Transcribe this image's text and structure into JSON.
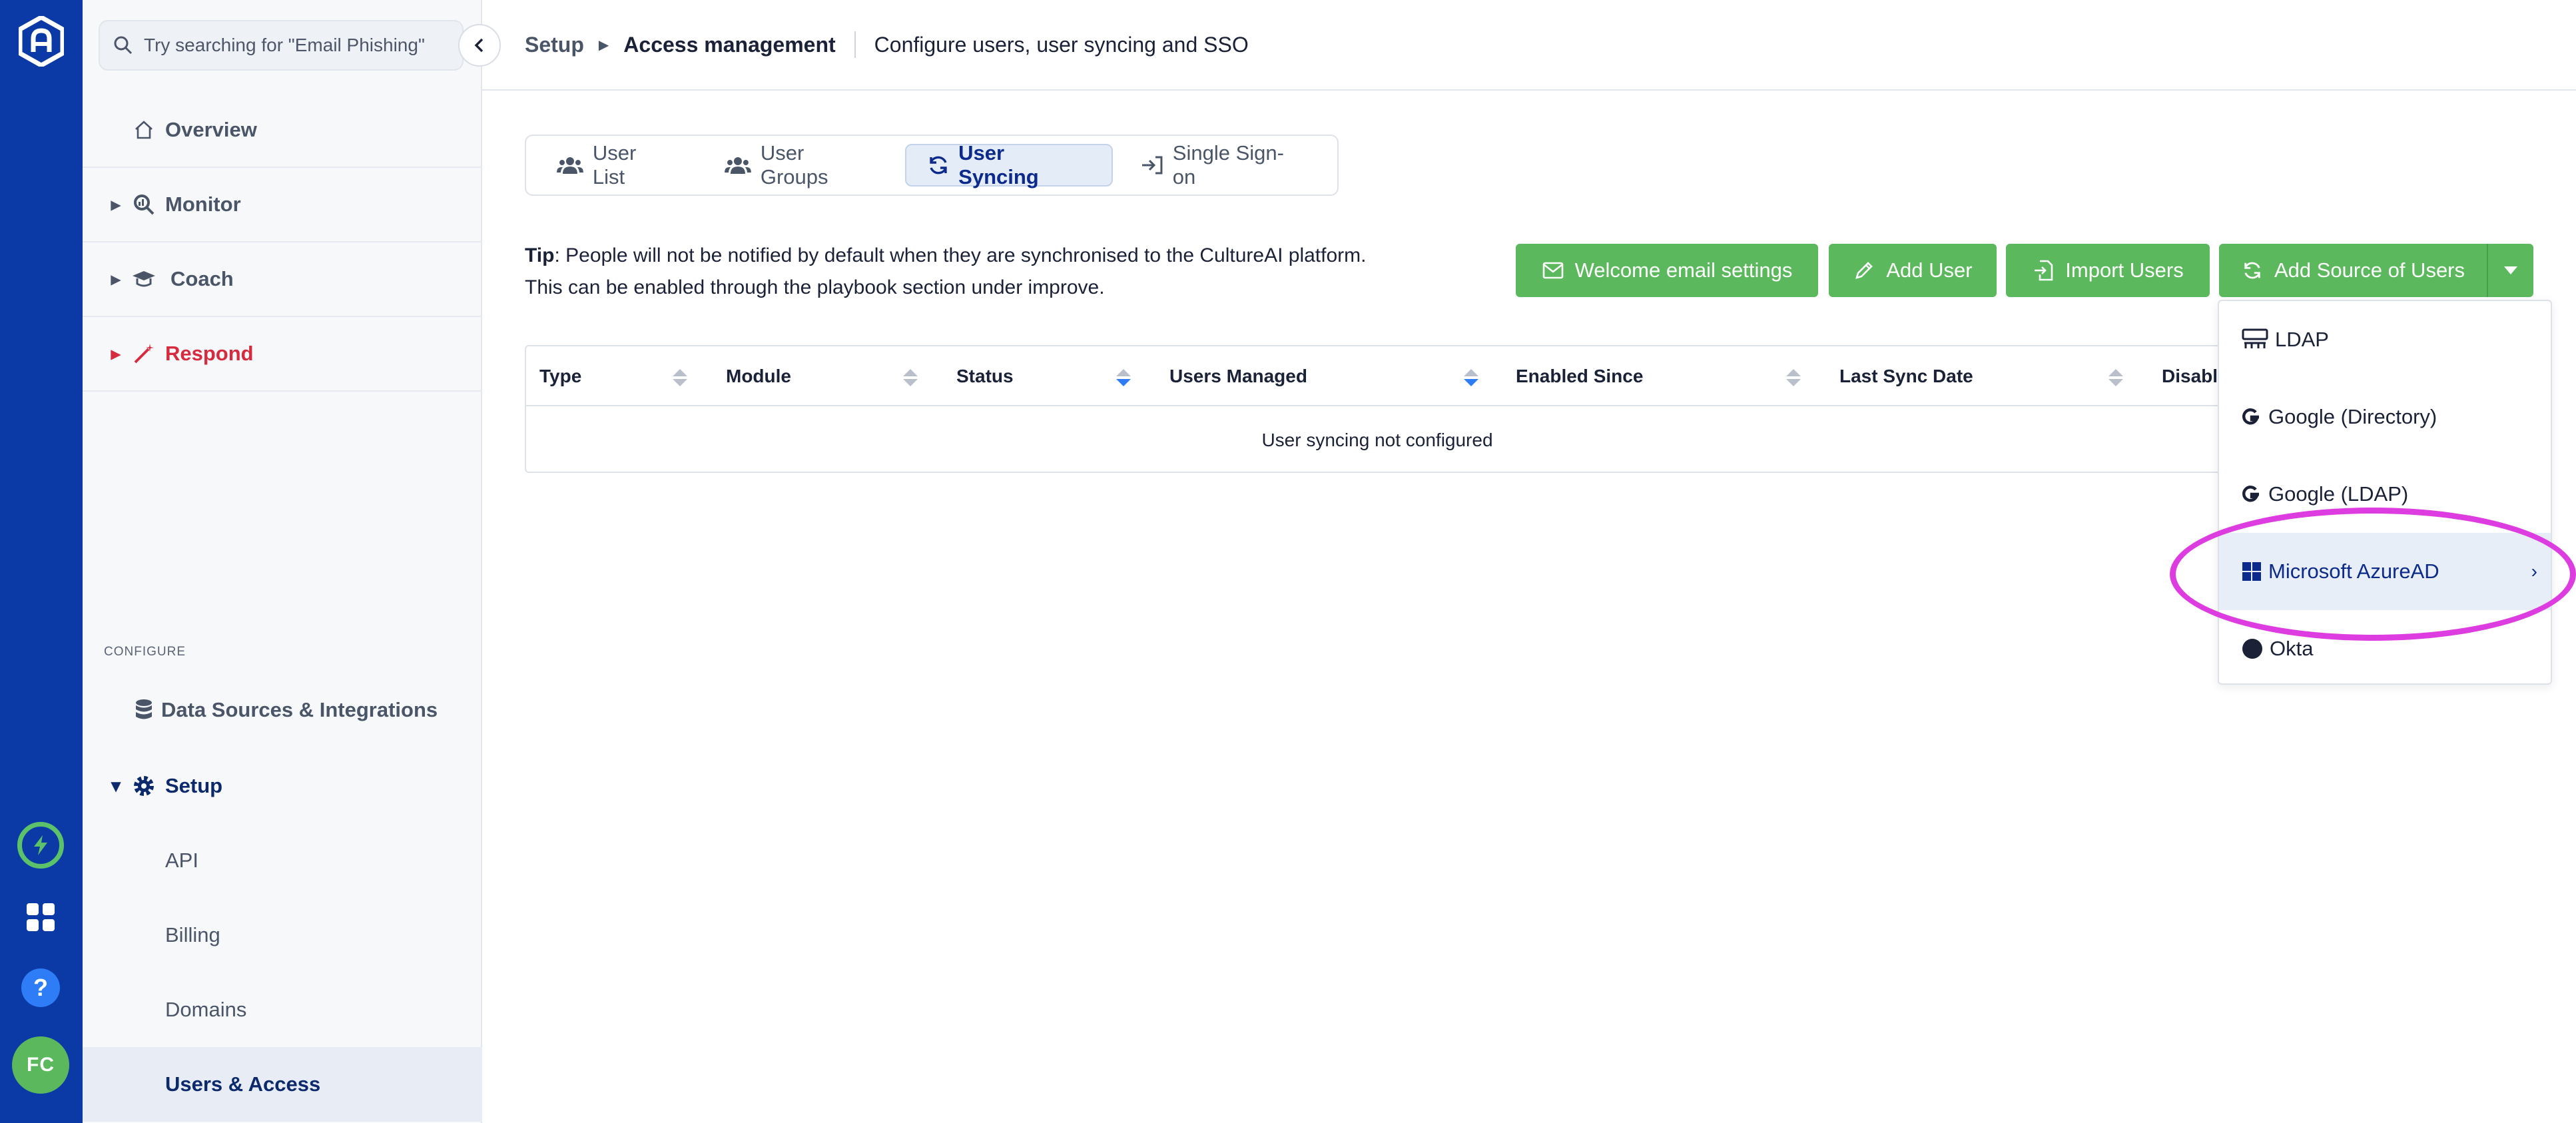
{
  "search": {
    "placeholder": "Try searching for \"Email Phishing\""
  },
  "sidebar": {
    "items": [
      {
        "label": "Overview"
      },
      {
        "label": "Monitor"
      },
      {
        "label": "Coach"
      },
      {
        "label": "Respond"
      }
    ],
    "configure_label": "CONFIGURE",
    "data_sources_label": "Data Sources & Integrations",
    "setup_label": "Setup",
    "setup_children": [
      {
        "label": "API"
      },
      {
        "label": "Billing"
      },
      {
        "label": "Domains"
      },
      {
        "label": "Users & Access"
      }
    ]
  },
  "rail": {
    "avatar_initials": "FC",
    "help": "?"
  },
  "header": {
    "breadcrumb_root": "Setup",
    "breadcrumb_current": "Access management",
    "description": "Configure users, user syncing and SSO"
  },
  "tabs": [
    {
      "label": "User List"
    },
    {
      "label": "User Groups"
    },
    {
      "label": "User Syncing"
    },
    {
      "label": "Single Sign-on"
    }
  ],
  "tip": {
    "prefix": "Tip",
    "line1": ": People will not be notified by default when they are synchronised to the CultureAI platform.",
    "line2": "This can be enabled through the playbook section under improve."
  },
  "actions": {
    "welcome": "Welcome email settings",
    "add_user": "Add User",
    "import": "Import Users",
    "add_source": "Add Source of Users"
  },
  "table": {
    "columns": [
      "Type",
      "Module",
      "Status",
      "Users Managed",
      "Enabled Since",
      "Last Sync Date",
      "Disable"
    ],
    "empty": "User syncing not configured"
  },
  "dropdown": {
    "items": [
      {
        "label": "LDAP"
      },
      {
        "label": "Google (Directory)"
      },
      {
        "label": "Google (LDAP)"
      },
      {
        "label": "Microsoft AzureAD"
      },
      {
        "label": "Okta"
      }
    ]
  },
  "colors": {
    "rail": "#0b3aa6",
    "primary_button": "#5cb85c",
    "active_tab": "#e4ecf8",
    "respond": "#d62b3f",
    "highlight": "#dd3de0"
  }
}
